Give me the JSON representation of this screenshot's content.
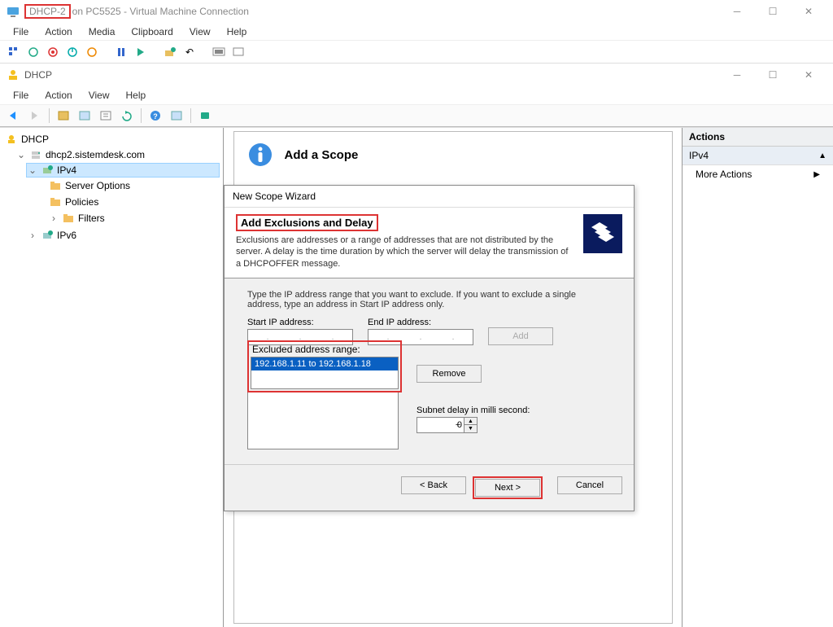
{
  "vm": {
    "title_highlight": "DHCP-2",
    "title_rest": "on PC5525 - Virtual Machine Connection",
    "menu": [
      "File",
      "Action",
      "Media",
      "Clipboard",
      "View",
      "Help"
    ]
  },
  "dhcp": {
    "title": "DHCP",
    "menu": [
      "File",
      "Action",
      "View",
      "Help"
    ]
  },
  "tree": {
    "root": "DHCP",
    "server": "dhcp2.sistemdesk.com",
    "ipv4": "IPv4",
    "ipv4_children": [
      "Server Options",
      "Policies",
      "Filters"
    ],
    "ipv6": "IPv6"
  },
  "center": {
    "header": "Add a Scope"
  },
  "wizard": {
    "window_title": "New Scope Wizard",
    "heading": "Add Exclusions and Delay",
    "desc": "Exclusions are addresses or a range of addresses that are not distributed by the server. A delay is the time duration by which the server will delay the transmission of a DHCPOFFER message.",
    "body_intro": "Type the IP address range that you want to exclude. If you want to exclude a single address, type an address in Start IP address only.",
    "start_label": "Start IP address:",
    "end_label": "End IP address:",
    "add_btn": "Add",
    "excluded_label": "Excluded address range:",
    "excluded_item": "192.168.1.11 to 192.168.1.18",
    "remove_btn": "Remove",
    "subnet_label": "Subnet delay in milli second:",
    "subnet_value": "0",
    "back_btn": "< Back",
    "next_btn": "Next >",
    "cancel_btn": "Cancel"
  },
  "actions": {
    "header": "Actions",
    "sub": "IPv4",
    "more": "More Actions"
  }
}
